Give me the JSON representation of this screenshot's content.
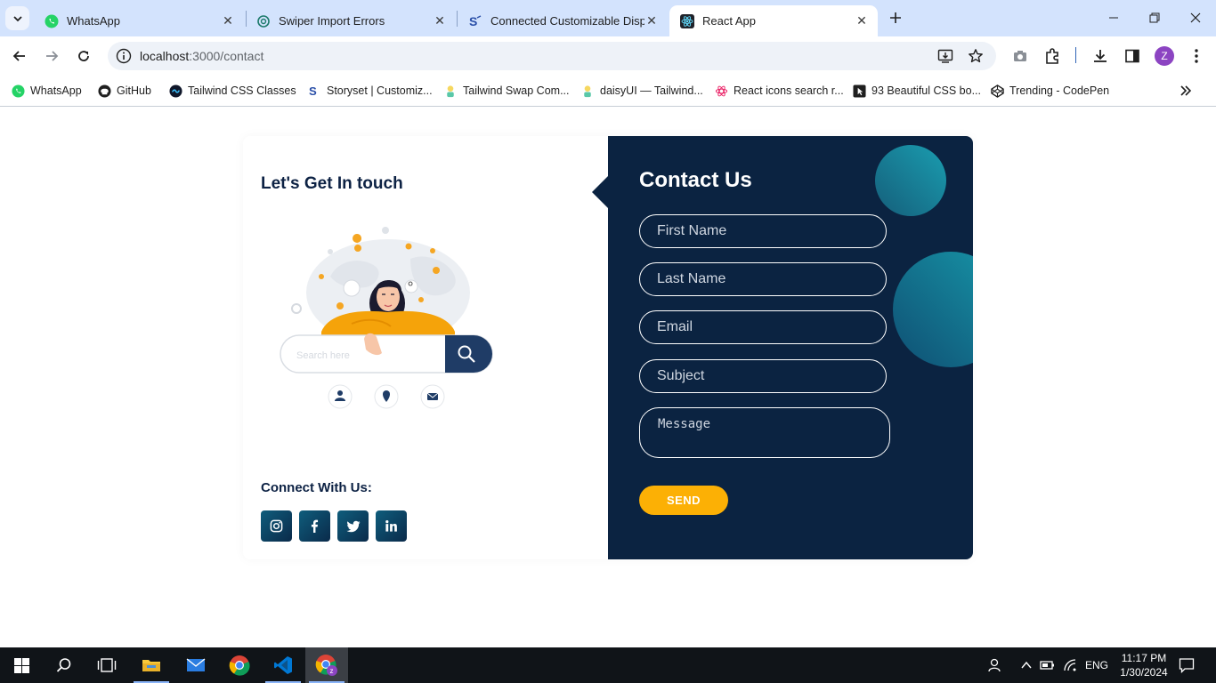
{
  "browser": {
    "tabs": [
      {
        "title": "WhatsApp",
        "favicon": "whatsapp-icon",
        "active": false
      },
      {
        "title": "Swiper Import Errors",
        "favicon": "openai-icon",
        "active": false
      },
      {
        "title": "Connected Customizable Dispr",
        "favicon": "storyset-icon",
        "active": false
      },
      {
        "title": "React App",
        "favicon": "react-icon",
        "active": true
      }
    ],
    "url_host": "localhost",
    "url_path": ":3000/contact",
    "bookmarks": [
      {
        "title": "WhatsApp",
        "icon": "whatsapp-icon"
      },
      {
        "title": "GitHub",
        "icon": "github-icon"
      },
      {
        "title": "Tailwind CSS Classes",
        "icon": "tailwind-icon"
      },
      {
        "title": "Storyset | Customiz...",
        "icon": "storyset-icon"
      },
      {
        "title": "Tailwind Swap Com...",
        "icon": "daisyui-icon"
      },
      {
        "title": "daisyUI — Tailwind...",
        "icon": "daisyui-icon"
      },
      {
        "title": "React icons search r...",
        "icon": "react-icons-icon"
      },
      {
        "title": "93 Beautiful CSS bo...",
        "icon": "cursor-icon"
      },
      {
        "title": "Trending - CodePen",
        "icon": "codepen-icon"
      }
    ],
    "profile_initial": "Z"
  },
  "contact": {
    "left_title": "Let's Get In touch",
    "search_placeholder": "Search here",
    "connect_title": "Connect With Us:",
    "socials": [
      "instagram-icon",
      "facebook-icon",
      "twitter-icon",
      "linkedin-icon"
    ],
    "form_title": "Contact Us",
    "first_name_placeholder": "First Name",
    "last_name_placeholder": "Last Name",
    "email_placeholder": "Email",
    "subject_placeholder": "Subject",
    "message_placeholder": "Message",
    "send_label": "SEND"
  },
  "taskbar": {
    "language": "ENG",
    "time": "11:17 PM",
    "date": "1/30/2024"
  },
  "colors": {
    "navy": "#0b2341",
    "accent": "#fcb005",
    "teal": "#1a9db0"
  }
}
